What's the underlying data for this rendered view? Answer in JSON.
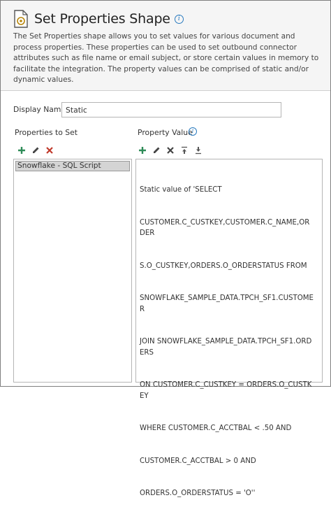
{
  "header": {
    "title": "Set Properties Shape",
    "info_icon": "info-icon",
    "shape_icon": "document-gear-icon",
    "description": "The Set Properties shape allows you to set values for various document and process properties. These properties can be used to set outbound connector attributes such as file name or email subject, or store certain values in memory to facilitate the integration. The property values can be comprised of static and/or dynamic values."
  },
  "display_name": {
    "label": "Display Name",
    "value": "Static"
  },
  "properties_to_set": {
    "label": "Properties to Set",
    "toolbar": [
      "add-icon",
      "edit-icon",
      "delete-icon"
    ],
    "items": [
      "Snowflake - SQL Script"
    ]
  },
  "property_value": {
    "label": "Property Value",
    "toolbar": [
      "add-icon",
      "edit-icon",
      "delete-icon",
      "move-up-icon",
      "move-down-icon"
    ],
    "lines": [
      "Static value of 'SELECT",
      "CUSTOMER.C_CUSTKEY,CUSTOMER.C_NAME,ORDER",
      "S.O_CUSTKEY,ORDERS.O_ORDERSTATUS FROM",
      "SNOWFLAKE_SAMPLE_DATA.TPCH_SF1.CUSTOMER",
      "JOIN SNOWFLAKE_SAMPLE_DATA.TPCH_SF1.ORDERS",
      "ON CUSTOMER.C_CUSTKEY = ORDERS.O_CUSTKEY",
      "WHERE CUSTOMER.C_ACCTBAL < .50 AND",
      "CUSTOMER.C_ACCTBAL > 0 AND",
      "ORDERS.O_ORDERSTATUS = 'O''"
    ]
  },
  "colors": {
    "add": "#2e8b57",
    "delete": "#c0392b",
    "edit": "#444444",
    "info": "#2a7bbf",
    "header_bg": "#f5f5f5",
    "selected_item": "#d4d4d4"
  }
}
